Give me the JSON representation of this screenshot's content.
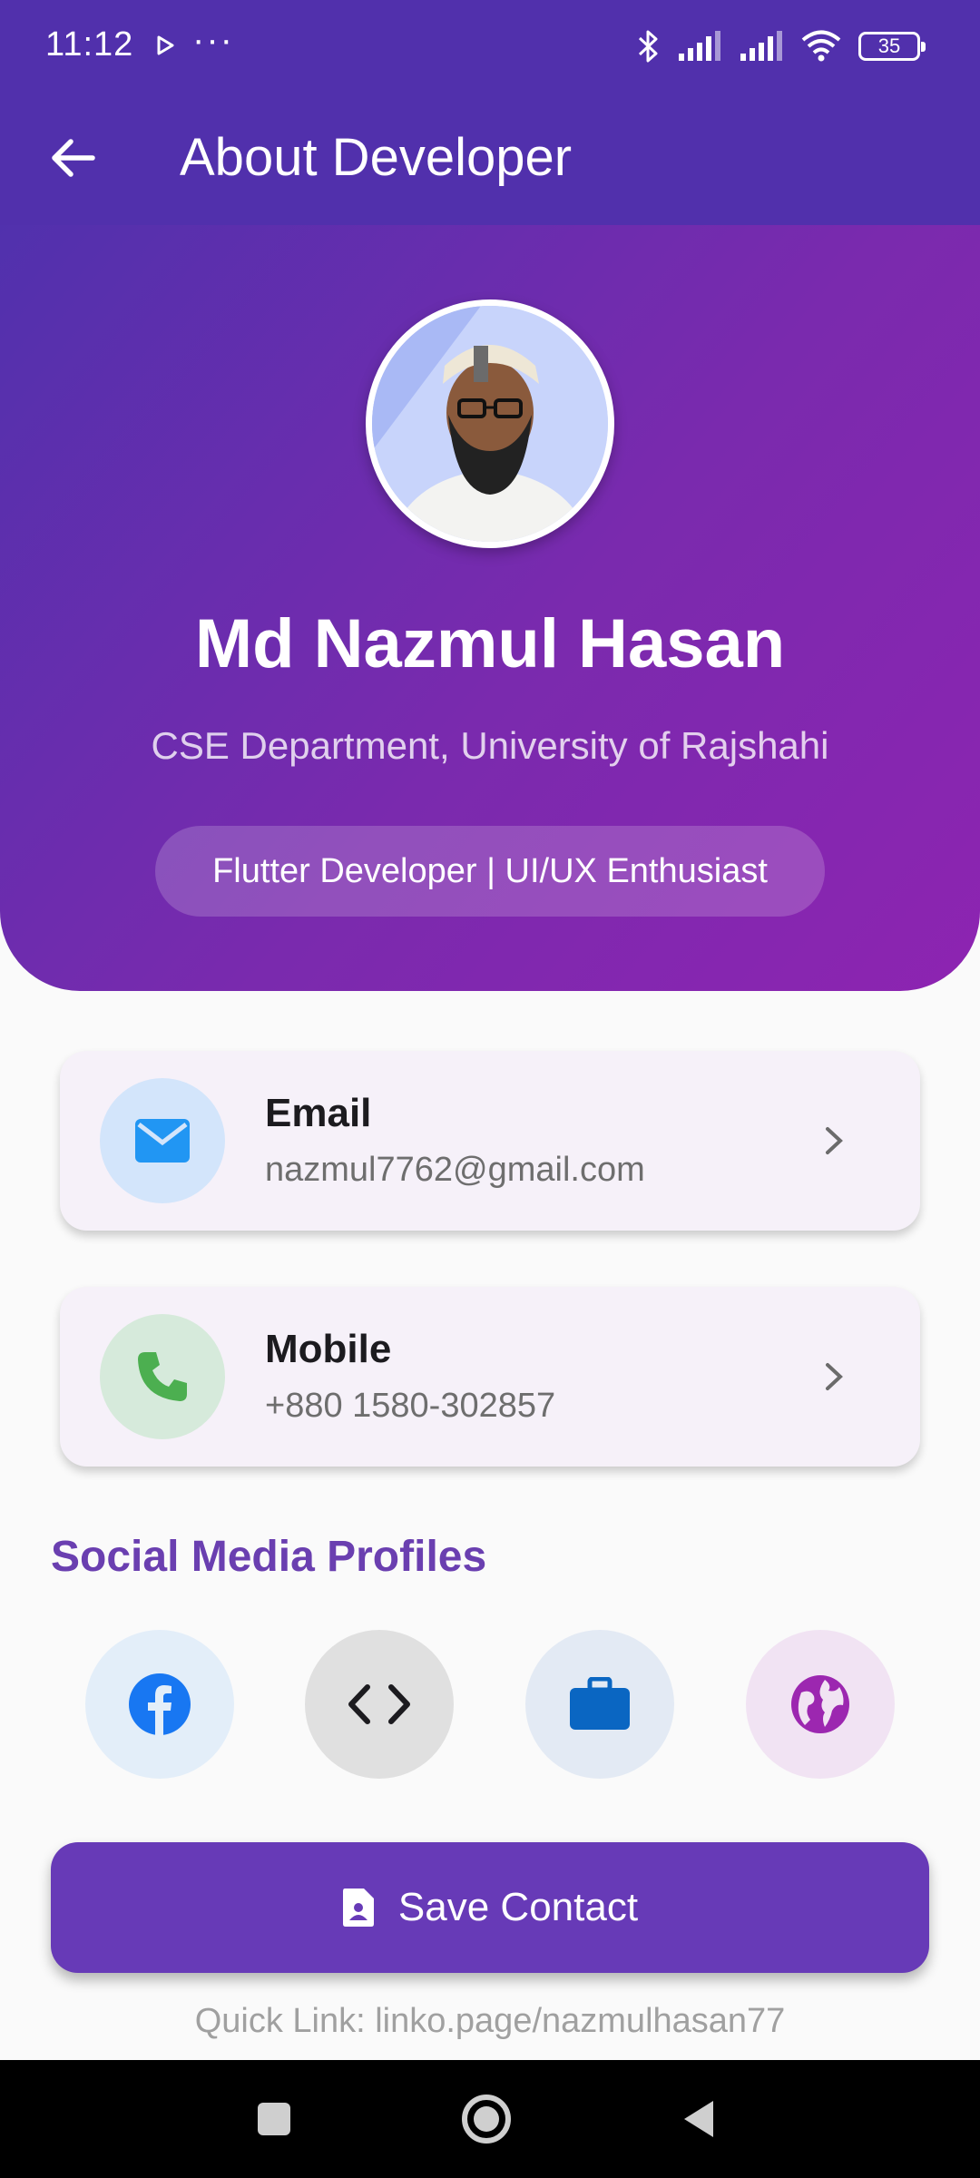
{
  "status_bar": {
    "time": "11:12",
    "battery": "35"
  },
  "app_bar": {
    "title": "About Developer"
  },
  "profile": {
    "name": "Md Nazmul Hasan",
    "department": "CSE Department, University of Rajshahi",
    "tagline": "Flutter Developer | UI/UX Enthusiast"
  },
  "contacts": [
    {
      "label": "Email",
      "value": "nazmul7762@gmail.com",
      "icon": "mail-icon",
      "color": "#2196f3",
      "bg": "#d3e5fb"
    },
    {
      "label": "Mobile",
      "value": "+880 1580-302857",
      "icon": "phone-icon",
      "color": "#4caf50",
      "bg": "#d6eadb"
    }
  ],
  "social": {
    "title": "Social Media Profiles",
    "items": [
      {
        "icon": "facebook-icon",
        "color": "#1877f2",
        "bg": "#e3eef9"
      },
      {
        "icon": "code-icon",
        "color": "#1c1b1f",
        "bg": "#e0e0e0"
      },
      {
        "icon": "briefcase-icon",
        "color": "#0a66c2",
        "bg": "#e3eaf4"
      },
      {
        "icon": "globe-icon",
        "color": "#9c27b0",
        "bg": "#f1e3f3"
      }
    ]
  },
  "actions": {
    "save_label": "Save Contact"
  },
  "footer": {
    "quick_link": "Quick Link: linko.page/nazmulhasan77"
  },
  "colors": {
    "primary": "#673ab7",
    "app_bar": "#5130ac",
    "accent_text": "#6a3fb0"
  }
}
